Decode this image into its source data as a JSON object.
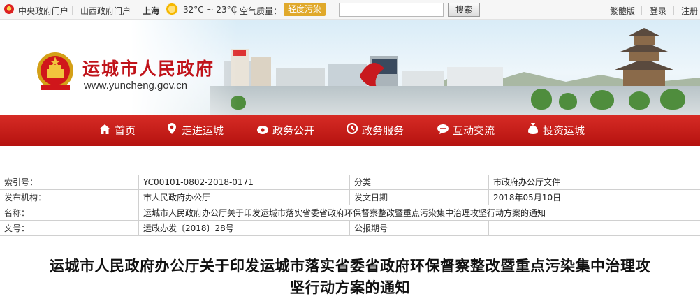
{
  "topbar": {
    "portal_links": [
      "中央政府门户",
      "山西政府门户"
    ],
    "city": "上海",
    "weather_icon": "sun-icon",
    "temperature": "32°C ~ 23°C",
    "air_quality_label": "空气质量：",
    "air_quality_value": "轻度污染",
    "air_quality_color": "#e0a92b",
    "search_button": "搜索",
    "search_value": "",
    "right_links": [
      "繁體版",
      "登录",
      "注册"
    ]
  },
  "header": {
    "site_name": "运城市人民政府",
    "site_url": "www.yuncheng.gov.cn",
    "brand_color": "#c0131a"
  },
  "nav": {
    "items": [
      {
        "label": "首页",
        "icon": "home-icon"
      },
      {
        "label": "走进运城",
        "icon": "location-pin-icon"
      },
      {
        "label": "政务公开",
        "icon": "eye-icon"
      },
      {
        "label": "政务服务",
        "icon": "service-icon"
      },
      {
        "label": "互动交流",
        "icon": "chat-bubble-icon"
      },
      {
        "label": "投资运城",
        "icon": "money-bag-icon"
      }
    ],
    "color": "#c41a16"
  },
  "meta": {
    "rows": [
      {
        "label1": "索引号：",
        "value1": "YC00101-0802-2018-0171",
        "label2": "分类",
        "value2": "市政府办公厅文件"
      },
      {
        "label1": "发布机构：",
        "value1": "市人民政府办公厅",
        "label2": "发文日期",
        "value2": "2018年05月10日"
      },
      {
        "label1": "名称：",
        "value1": "运城市人民政府办公厅关于印发运城市落实省委省政府环保督察整改暨重点污染集中治理攻坚行动方案的通知"
      },
      {
        "label1": "文号：",
        "value1": "运政办发〔2018〕28号",
        "label2": "公报期号",
        "value2": ""
      }
    ]
  },
  "article": {
    "title_line1": "运城市人民政府办公厅关于印发运城市落实省委省政府环保督察整改暨重点污染集中治理攻",
    "title_line2": "坚行动方案的通知"
  }
}
